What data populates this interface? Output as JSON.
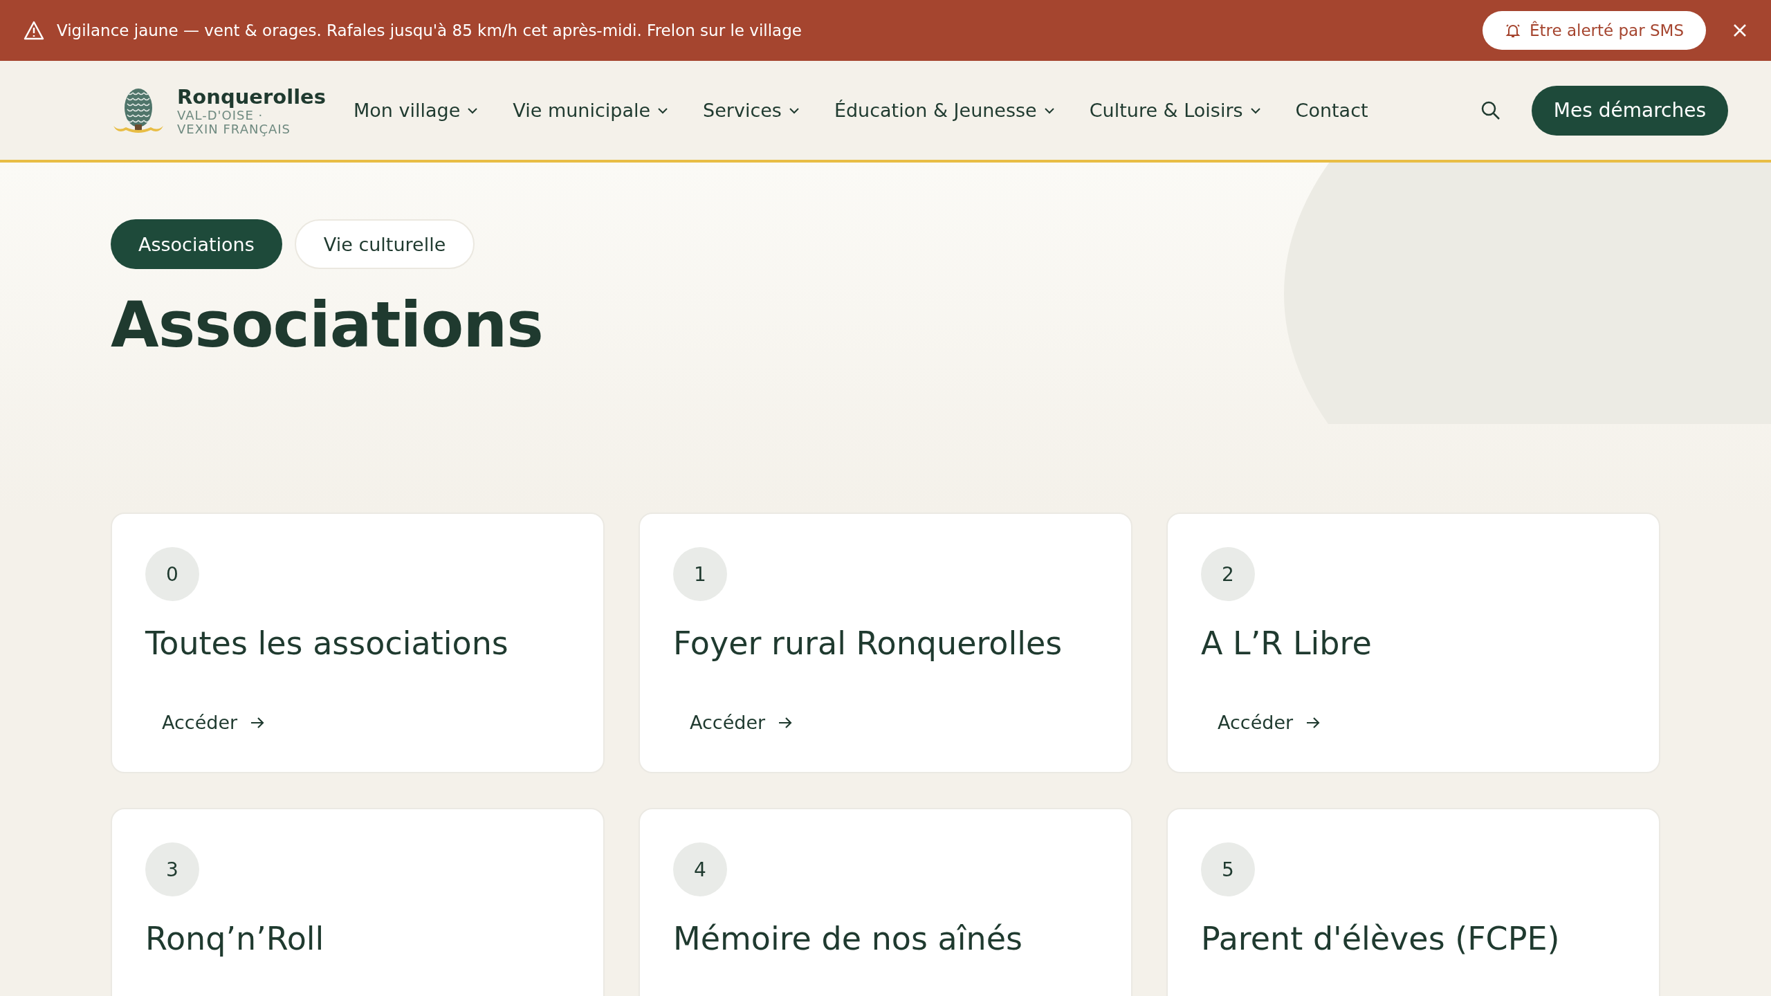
{
  "alert": {
    "message": "Vigilance jaune — vent & orages. Rafales jusqu'à 85 km/h cet après-midi. Frelon sur le village",
    "action": "Être alerté par SMS"
  },
  "header": {
    "site_name": "Ronquerolles",
    "tagline_lines": [
      "VAL-D'OISE ·",
      "VEXIN FRANÇAIS"
    ],
    "nav": [
      {
        "label": "Mon village",
        "has_menu": true
      },
      {
        "label": "Vie municipale",
        "has_menu": true
      },
      {
        "label": "Services",
        "has_menu": true
      },
      {
        "label": "Éducation & Jeunesse",
        "has_menu": true
      },
      {
        "label": "Culture & Loisirs",
        "has_menu": true
      },
      {
        "label": "Contact",
        "has_menu": false
      }
    ],
    "cta": "Mes démarches"
  },
  "tabs": [
    {
      "label": "Associations",
      "selected": true
    },
    {
      "label": "Vie culturelle",
      "selected": false
    }
  ],
  "title": "Associations",
  "cards": [
    {
      "number": "0",
      "title": "Toutes les associations",
      "link": "Accéder"
    },
    {
      "number": "1",
      "title": "Foyer rural Ronquerolles",
      "link": "Accéder"
    },
    {
      "number": "2",
      "title": "A L’R Libre",
      "link": "Accéder"
    },
    {
      "number": "3",
      "title": "Ronq’n’Roll"
    },
    {
      "number": "4",
      "title": "Mémoire de nos aînés"
    },
    {
      "number": "5",
      "title": "Parent d'élèves (FCPE)"
    }
  ]
}
